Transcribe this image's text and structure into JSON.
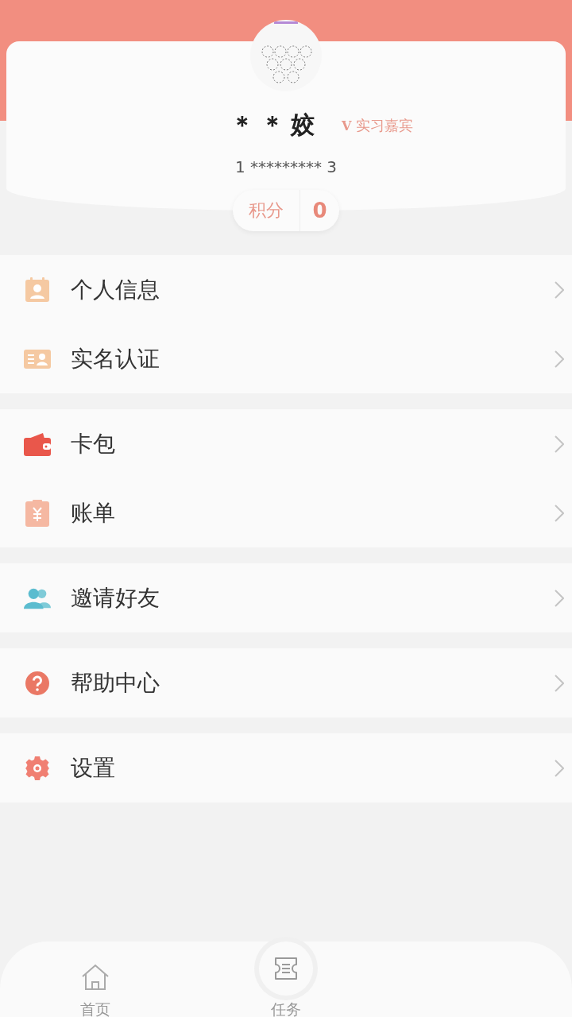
{
  "profile": {
    "name": "＊＊姣",
    "badge_mark": "V",
    "badge": "实习嘉宾",
    "phone": "1 ********* 3",
    "points_label": "积分",
    "points": "0"
  },
  "menu_groups": [
    {
      "items": [
        {
          "kind": "profile",
          "label": "个人信息"
        },
        {
          "kind": "idcard",
          "label": "实名认证"
        }
      ]
    },
    {
      "items": [
        {
          "kind": "wallet",
          "label": "卡包"
        },
        {
          "kind": "bill",
          "label": "账单"
        }
      ]
    },
    {
      "items": [
        {
          "kind": "friends",
          "label": "邀请好友"
        }
      ]
    },
    {
      "items": [
        {
          "kind": "help",
          "label": "帮助中心"
        }
      ]
    },
    {
      "items": [
        {
          "kind": "settings",
          "label": "设置"
        }
      ]
    }
  ],
  "nav": [
    {
      "kind": "home",
      "label": "首页",
      "selected": false
    },
    {
      "kind": "task",
      "label": "任务",
      "selected": false
    }
  ]
}
